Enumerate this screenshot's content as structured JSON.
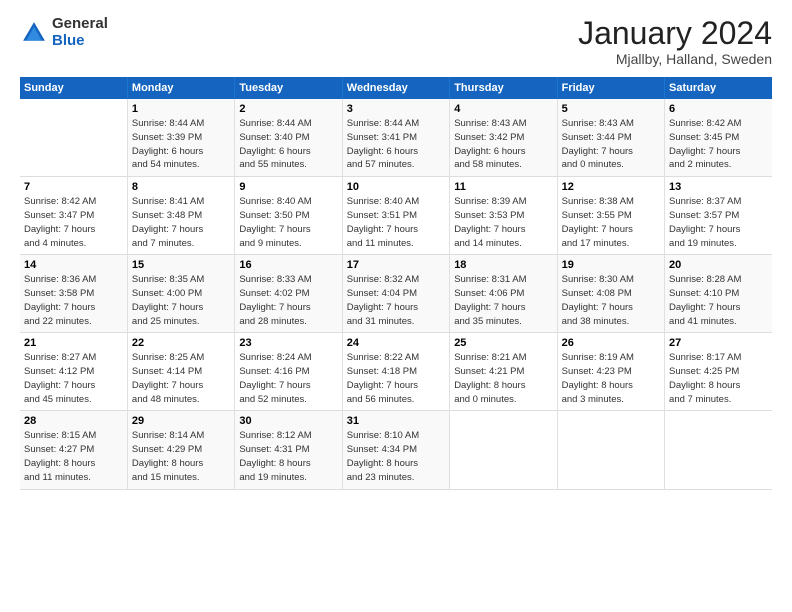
{
  "header": {
    "logo_general": "General",
    "logo_blue": "Blue",
    "month_title": "January 2024",
    "location": "Mjallby, Halland, Sweden"
  },
  "days_of_week": [
    "Sunday",
    "Monday",
    "Tuesday",
    "Wednesday",
    "Thursday",
    "Friday",
    "Saturday"
  ],
  "weeks": [
    [
      {
        "num": "",
        "info": ""
      },
      {
        "num": "1",
        "info": "Sunrise: 8:44 AM\nSunset: 3:39 PM\nDaylight: 6 hours\nand 54 minutes."
      },
      {
        "num": "2",
        "info": "Sunrise: 8:44 AM\nSunset: 3:40 PM\nDaylight: 6 hours\nand 55 minutes."
      },
      {
        "num": "3",
        "info": "Sunrise: 8:44 AM\nSunset: 3:41 PM\nDaylight: 6 hours\nand 57 minutes."
      },
      {
        "num": "4",
        "info": "Sunrise: 8:43 AM\nSunset: 3:42 PM\nDaylight: 6 hours\nand 58 minutes."
      },
      {
        "num": "5",
        "info": "Sunrise: 8:43 AM\nSunset: 3:44 PM\nDaylight: 7 hours\nand 0 minutes."
      },
      {
        "num": "6",
        "info": "Sunrise: 8:42 AM\nSunset: 3:45 PM\nDaylight: 7 hours\nand 2 minutes."
      }
    ],
    [
      {
        "num": "7",
        "info": "Sunrise: 8:42 AM\nSunset: 3:47 PM\nDaylight: 7 hours\nand 4 minutes."
      },
      {
        "num": "8",
        "info": "Sunrise: 8:41 AM\nSunset: 3:48 PM\nDaylight: 7 hours\nand 7 minutes."
      },
      {
        "num": "9",
        "info": "Sunrise: 8:40 AM\nSunset: 3:50 PM\nDaylight: 7 hours\nand 9 minutes."
      },
      {
        "num": "10",
        "info": "Sunrise: 8:40 AM\nSunset: 3:51 PM\nDaylight: 7 hours\nand 11 minutes."
      },
      {
        "num": "11",
        "info": "Sunrise: 8:39 AM\nSunset: 3:53 PM\nDaylight: 7 hours\nand 14 minutes."
      },
      {
        "num": "12",
        "info": "Sunrise: 8:38 AM\nSunset: 3:55 PM\nDaylight: 7 hours\nand 17 minutes."
      },
      {
        "num": "13",
        "info": "Sunrise: 8:37 AM\nSunset: 3:57 PM\nDaylight: 7 hours\nand 19 minutes."
      }
    ],
    [
      {
        "num": "14",
        "info": "Sunrise: 8:36 AM\nSunset: 3:58 PM\nDaylight: 7 hours\nand 22 minutes."
      },
      {
        "num": "15",
        "info": "Sunrise: 8:35 AM\nSunset: 4:00 PM\nDaylight: 7 hours\nand 25 minutes."
      },
      {
        "num": "16",
        "info": "Sunrise: 8:33 AM\nSunset: 4:02 PM\nDaylight: 7 hours\nand 28 minutes."
      },
      {
        "num": "17",
        "info": "Sunrise: 8:32 AM\nSunset: 4:04 PM\nDaylight: 7 hours\nand 31 minutes."
      },
      {
        "num": "18",
        "info": "Sunrise: 8:31 AM\nSunset: 4:06 PM\nDaylight: 7 hours\nand 35 minutes."
      },
      {
        "num": "19",
        "info": "Sunrise: 8:30 AM\nSunset: 4:08 PM\nDaylight: 7 hours\nand 38 minutes."
      },
      {
        "num": "20",
        "info": "Sunrise: 8:28 AM\nSunset: 4:10 PM\nDaylight: 7 hours\nand 41 minutes."
      }
    ],
    [
      {
        "num": "21",
        "info": "Sunrise: 8:27 AM\nSunset: 4:12 PM\nDaylight: 7 hours\nand 45 minutes."
      },
      {
        "num": "22",
        "info": "Sunrise: 8:25 AM\nSunset: 4:14 PM\nDaylight: 7 hours\nand 48 minutes."
      },
      {
        "num": "23",
        "info": "Sunrise: 8:24 AM\nSunset: 4:16 PM\nDaylight: 7 hours\nand 52 minutes."
      },
      {
        "num": "24",
        "info": "Sunrise: 8:22 AM\nSunset: 4:18 PM\nDaylight: 7 hours\nand 56 minutes."
      },
      {
        "num": "25",
        "info": "Sunrise: 8:21 AM\nSunset: 4:21 PM\nDaylight: 8 hours\nand 0 minutes."
      },
      {
        "num": "26",
        "info": "Sunrise: 8:19 AM\nSunset: 4:23 PM\nDaylight: 8 hours\nand 3 minutes."
      },
      {
        "num": "27",
        "info": "Sunrise: 8:17 AM\nSunset: 4:25 PM\nDaylight: 8 hours\nand 7 minutes."
      }
    ],
    [
      {
        "num": "28",
        "info": "Sunrise: 8:15 AM\nSunset: 4:27 PM\nDaylight: 8 hours\nand 11 minutes."
      },
      {
        "num": "29",
        "info": "Sunrise: 8:14 AM\nSunset: 4:29 PM\nDaylight: 8 hours\nand 15 minutes."
      },
      {
        "num": "30",
        "info": "Sunrise: 8:12 AM\nSunset: 4:31 PM\nDaylight: 8 hours\nand 19 minutes."
      },
      {
        "num": "31",
        "info": "Sunrise: 8:10 AM\nSunset: 4:34 PM\nDaylight: 8 hours\nand 23 minutes."
      },
      {
        "num": "",
        "info": ""
      },
      {
        "num": "",
        "info": ""
      },
      {
        "num": "",
        "info": ""
      }
    ]
  ]
}
